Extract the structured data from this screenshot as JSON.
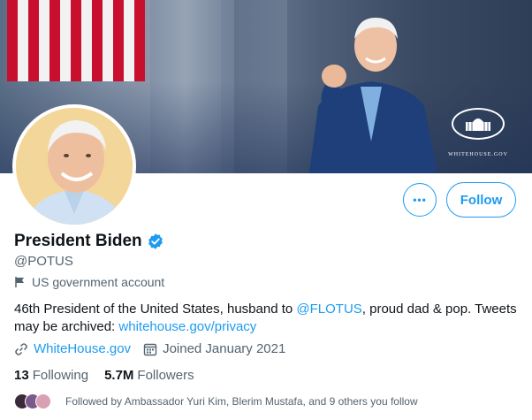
{
  "banner": {
    "logo_label": "WHITEHOUSE.GOV",
    "flag_colors": [
      "#c8102e",
      "#ffffff"
    ],
    "sky_color": "#3a4a62"
  },
  "actions": {
    "more_label": "•••",
    "follow_label": "Follow"
  },
  "profile": {
    "display_name": "President Biden",
    "handle": "@POTUS",
    "account_label": "US government account",
    "bio_prefix": "46th President of the United States, husband to ",
    "bio_mention": "@FLOTUS",
    "bio_middle": ", proud dad & pop. Tweets may be archived: ",
    "bio_link": "whitehouse.gov/privacy",
    "website": "WhiteHouse.gov",
    "joined": "Joined January 2021"
  },
  "stats": {
    "following_count": "13",
    "following_label": "Following",
    "followers_count": "5.7M",
    "followers_label": "Followers"
  },
  "followed_by": {
    "text": "Followed by Ambassador Yuri Kim, Blerim Mustafa, and 9 others you follow",
    "avatar_colors": [
      "#3b2a3a",
      "#7a5a8c",
      "#d8a0b0"
    ]
  },
  "colors": {
    "accent": "#1d9bf0",
    "text_primary": "#0f1419",
    "text_secondary": "#536471",
    "avatar_bg": "#f3d79a"
  },
  "icons": [
    "flag-icon",
    "link-icon",
    "calendar-icon",
    "verified-badge-icon",
    "more-icon"
  ]
}
